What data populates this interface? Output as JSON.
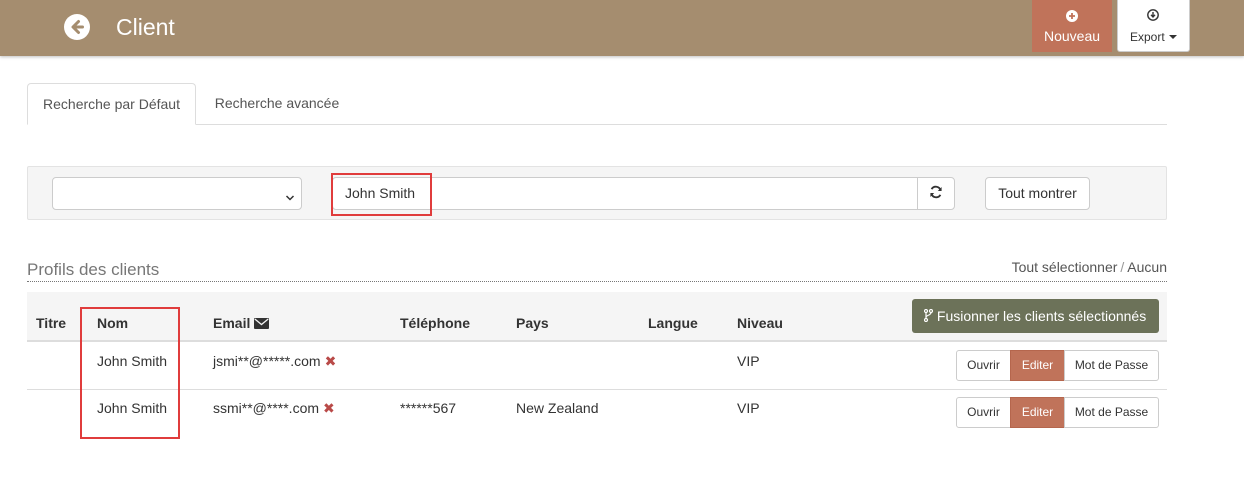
{
  "header": {
    "title": "Client",
    "new_label": "Nouveau",
    "export_label": "Export"
  },
  "tabs": [
    {
      "label": "Recherche par Défaut",
      "active": true
    },
    {
      "label": "Recherche avancée",
      "active": false
    }
  ],
  "search": {
    "select_value": "",
    "query": "John Smith",
    "show_all_label": "Tout montrer"
  },
  "section": {
    "title": "Profils des clients",
    "select_all": "Tout sélectionner",
    "separator": "/",
    "select_none": "Aucun"
  },
  "table": {
    "columns": [
      "Titre",
      "Nom",
      "Email",
      "Téléphone",
      "Pays",
      "Langue",
      "Niveau"
    ],
    "merge_label": "Fusionner les clients sélectionnés",
    "rows": [
      {
        "title": "",
        "name": "John Smith",
        "email": "jsmi**@*****.com",
        "phone": "",
        "country": "",
        "language": "",
        "level": "VIP"
      },
      {
        "title": "",
        "name": "John Smith",
        "email": "ssmi**@****.com",
        "phone": "******567",
        "country": "New Zealand",
        "language": "",
        "level": "VIP"
      }
    ],
    "row_actions": {
      "open": "Ouvrir",
      "edit": "Editer",
      "password": "Mot de Passe"
    }
  },
  "colors": {
    "topbar": "#a58d6f",
    "accent": "#c0735a",
    "merge_button": "#6c7259",
    "highlight": "#e03c3c"
  },
  "icons": {
    "back": "arrow-circle-left-icon",
    "new": "plus-circle-icon",
    "export": "download-circle-icon",
    "refresh": "refresh-icon",
    "email": "envelope-icon",
    "merge": "code-fork-icon",
    "delete_email": "times-icon"
  }
}
